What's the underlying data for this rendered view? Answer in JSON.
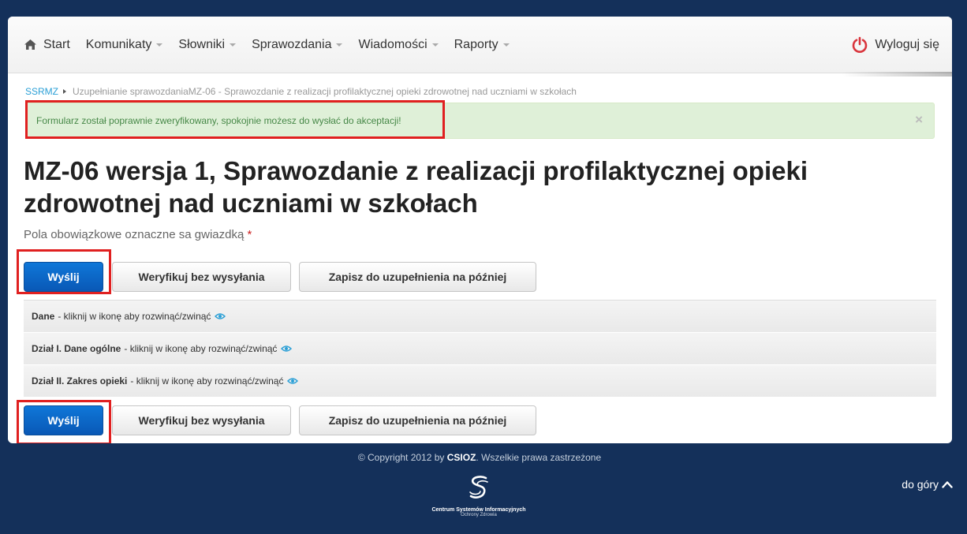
{
  "navbar": {
    "items": [
      {
        "label": "Start",
        "icon": "home-icon",
        "dropdown": false
      },
      {
        "label": "Komunikaty",
        "dropdown": true
      },
      {
        "label": "Słowniki",
        "dropdown": true
      },
      {
        "label": "Sprawozdania",
        "dropdown": true
      },
      {
        "label": "Wiadomości",
        "dropdown": true
      },
      {
        "label": "Raporty",
        "dropdown": true
      }
    ],
    "logout_label": "Wyloguj się"
  },
  "breadcrumb": {
    "root": "SSRMZ",
    "current": "Uzupełnianie sprawozdaniaMZ-06 - Sprawozdanie z realizacji profilaktycznej opieki zdrowotnej nad uczniami w szkołach"
  },
  "alert": {
    "text": "Formularz został poprawnie zweryfikowany, spokojnie możesz do wysłać do akceptacji!",
    "close": "×"
  },
  "page": {
    "title": "MZ-06 wersja 1, Sprawozdanie z realizacji profilaktycznej opieki zdrowotnej nad uczniami w szkołach",
    "required_note": "Pola obowiązkowe oznaczne sa gwiazdką",
    "required_mark": "*"
  },
  "buttons": {
    "send": "Wyślij",
    "verify": "Weryfikuj bez wysyłania",
    "save": "Zapisz do uzupełnienia na później"
  },
  "sections": [
    {
      "title": "Dane",
      "hint": "- kliknij w ikonę aby rozwinąć/zwinąć"
    },
    {
      "title": "Dział I. Dane ogólne",
      "hint": "- kliknij w ikonę aby rozwinąć/zwinąć"
    },
    {
      "title": "Dział II. Zakres opieki",
      "hint": "- kliknij w ikonę aby rozwinąć/zwinąć"
    }
  ],
  "footer": {
    "copyright_prefix": "© Copyright 2012 by ",
    "copyright_brand": "CSIOZ",
    "copyright_suffix": ". Wszelkie prawa zastrzeżone",
    "logo_line1": "Centrum Systemów Informacyjnych",
    "logo_line2": "Ochrony Zdrowia",
    "to_top": "do góry"
  },
  "colors": {
    "background": "#14305a",
    "primary": "#0a66c8",
    "alert_bg": "#dff0d8",
    "alert_text": "#468847",
    "highlight": "#e02020",
    "link": "#2a9fd6"
  }
}
